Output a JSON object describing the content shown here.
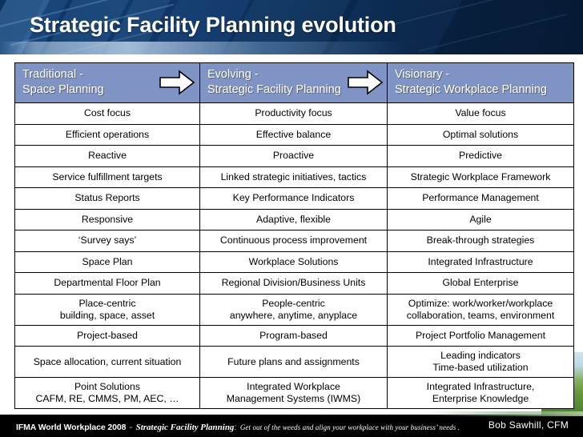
{
  "slide": {
    "title": "Strategic Facility Planning evolution"
  },
  "matrix": {
    "columns": [
      {
        "line1": "Traditional -",
        "line2": "Space Planning"
      },
      {
        "line1": "Evolving -",
        "line2": "Strategic Facility Planning"
      },
      {
        "line1": "Visionary -",
        "line2": "Strategic Workplace Planning"
      }
    ],
    "arrows": [
      {
        "name": "arrow-traditional-to-evolving"
      },
      {
        "name": "arrow-evolving-to-visionary"
      }
    ],
    "rows": [
      {
        "cells": [
          {
            "line1": "Cost focus"
          },
          {
            "line1": "Productivity focus"
          },
          {
            "line1": "Value focus"
          }
        ]
      },
      {
        "cells": [
          {
            "line1": "Efficient operations"
          },
          {
            "line1": "Effective balance"
          },
          {
            "line1": "Optimal solutions"
          }
        ]
      },
      {
        "cells": [
          {
            "line1": "Reactive"
          },
          {
            "line1": "Proactive"
          },
          {
            "line1": "Predictive"
          }
        ]
      },
      {
        "cells": [
          {
            "line1": "Service fulfillment targets"
          },
          {
            "line1": "Linked strategic initiatives, tactics"
          },
          {
            "line1": "Strategic Workplace Framework"
          }
        ]
      },
      {
        "cells": [
          {
            "line1": "Status Reports"
          },
          {
            "line1": "Key Performance Indicators"
          },
          {
            "line1": "Performance Management"
          }
        ]
      },
      {
        "cells": [
          {
            "line1": "Responsive"
          },
          {
            "line1": "Adaptive, flexible"
          },
          {
            "line1": "Agile"
          }
        ]
      },
      {
        "cells": [
          {
            "line1": "‘Survey says’"
          },
          {
            "line1": "Continuous process improvement"
          },
          {
            "line1": "Break-through strategies"
          }
        ]
      },
      {
        "cells": [
          {
            "line1": "Space Plan"
          },
          {
            "line1": "Workplace Solutions"
          },
          {
            "line1": "Integrated Infrastructure"
          }
        ]
      },
      {
        "cells": [
          {
            "line1": "Departmental Floor Plan"
          },
          {
            "line1": "Regional Division/Business Units"
          },
          {
            "line1": "Global Enterprise"
          }
        ]
      },
      {
        "tall": true,
        "cells": [
          {
            "line1": "Place-centric",
            "line2": "building, space, asset"
          },
          {
            "line1": "People-centric",
            "line2": "anywhere, anytime, anyplace"
          },
          {
            "line1": "Optimize: work/worker/workplace",
            "line2": "collaboration, teams, environment"
          }
        ]
      },
      {
        "cells": [
          {
            "line1": "Project-based"
          },
          {
            "line1": "Program-based"
          },
          {
            "line1": "Project Portfolio Management"
          }
        ]
      },
      {
        "tall": true,
        "cells": [
          {
            "line1": "Space allocation, current situation"
          },
          {
            "line1": "Future plans and assignments"
          },
          {
            "line1": "Leading indicators",
            "line2": "Time-based utilization"
          }
        ]
      },
      {
        "tall": true,
        "cells": [
          {
            "line1": "Point Solutions",
            "line2": "CAFM, RE, CMMS, PM, AEC, …"
          },
          {
            "line1": "Integrated Workplace",
            "line2": "Management Systems (IWMS)"
          },
          {
            "line1": "Integrated Infrastructure,",
            "line2": "Enterprise Knowledge"
          }
        ]
      }
    ]
  },
  "footer": {
    "event": "IFMA World Workplace 2008",
    "dash": "-",
    "topic": "Strategic Facility Planning",
    "colon": ":",
    "tagline": "Get out of the weeds and align your workplace with your business’ needs .",
    "presenter": "Bob Sawhill, CFM"
  },
  "colors": {
    "header_band_dark": "#08203f",
    "header_band_blue": "#10396b",
    "matrix_header_fill": "#7f94c4",
    "matrix_border": "#000000",
    "footer_bg": "#000000",
    "green_accent": "#63933c"
  }
}
